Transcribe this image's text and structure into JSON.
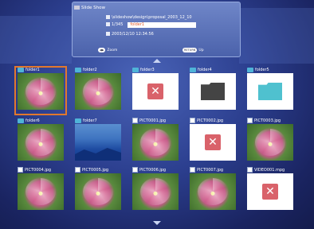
{
  "info": {
    "title": "Slide Show",
    "path": "\\slideshow\\design\\proposal_2003_12_10",
    "count": "1/345",
    "folder": "folder1",
    "datetime": "2003/12/10 12:34:56",
    "zoom_label": "Zoom",
    "up_label": "Up",
    "zoom_key": "◀▶",
    "up_key": "RETURN"
  },
  "grid": [
    {
      "label": "folder1",
      "type": "folder",
      "thumb": "flower",
      "selected": true
    },
    {
      "label": "folder2",
      "type": "folder",
      "thumb": "flower"
    },
    {
      "label": "folder3",
      "type": "folder",
      "thumb": "error"
    },
    {
      "label": "folder4",
      "type": "folder",
      "thumb": "dark-folder"
    },
    {
      "label": "folder5",
      "type": "folder",
      "thumb": "teal-folder"
    },
    {
      "label": "folder6",
      "type": "folder",
      "thumb": "flower"
    },
    {
      "label": "folder7",
      "type": "folder",
      "thumb": "landscape"
    },
    {
      "label": "PICT0001.jpg",
      "type": "photo",
      "thumb": "flower"
    },
    {
      "label": "PICT0002.jpg",
      "type": "photo",
      "thumb": "error"
    },
    {
      "label": "PICT0003.jpg",
      "type": "photo",
      "thumb": "flower"
    },
    {
      "label": "PICT0004.jpg",
      "type": "photo",
      "thumb": "flower"
    },
    {
      "label": "PICT0005.jpg",
      "type": "photo",
      "thumb": "flower"
    },
    {
      "label": "PICT0006.jpg",
      "type": "photo",
      "thumb": "flower"
    },
    {
      "label": "PICT0007.jpg",
      "type": "photo",
      "thumb": "flower"
    },
    {
      "label": "VIDEO001.mpg",
      "type": "video",
      "thumb": "error"
    }
  ],
  "colors": {
    "selection": "#e2782d",
    "error": "#d9626a",
    "background": "#1e2b6b"
  },
  "icons": {
    "up": "chevron-up-icon",
    "down": "chevron-down-icon",
    "error": "x-icon"
  }
}
